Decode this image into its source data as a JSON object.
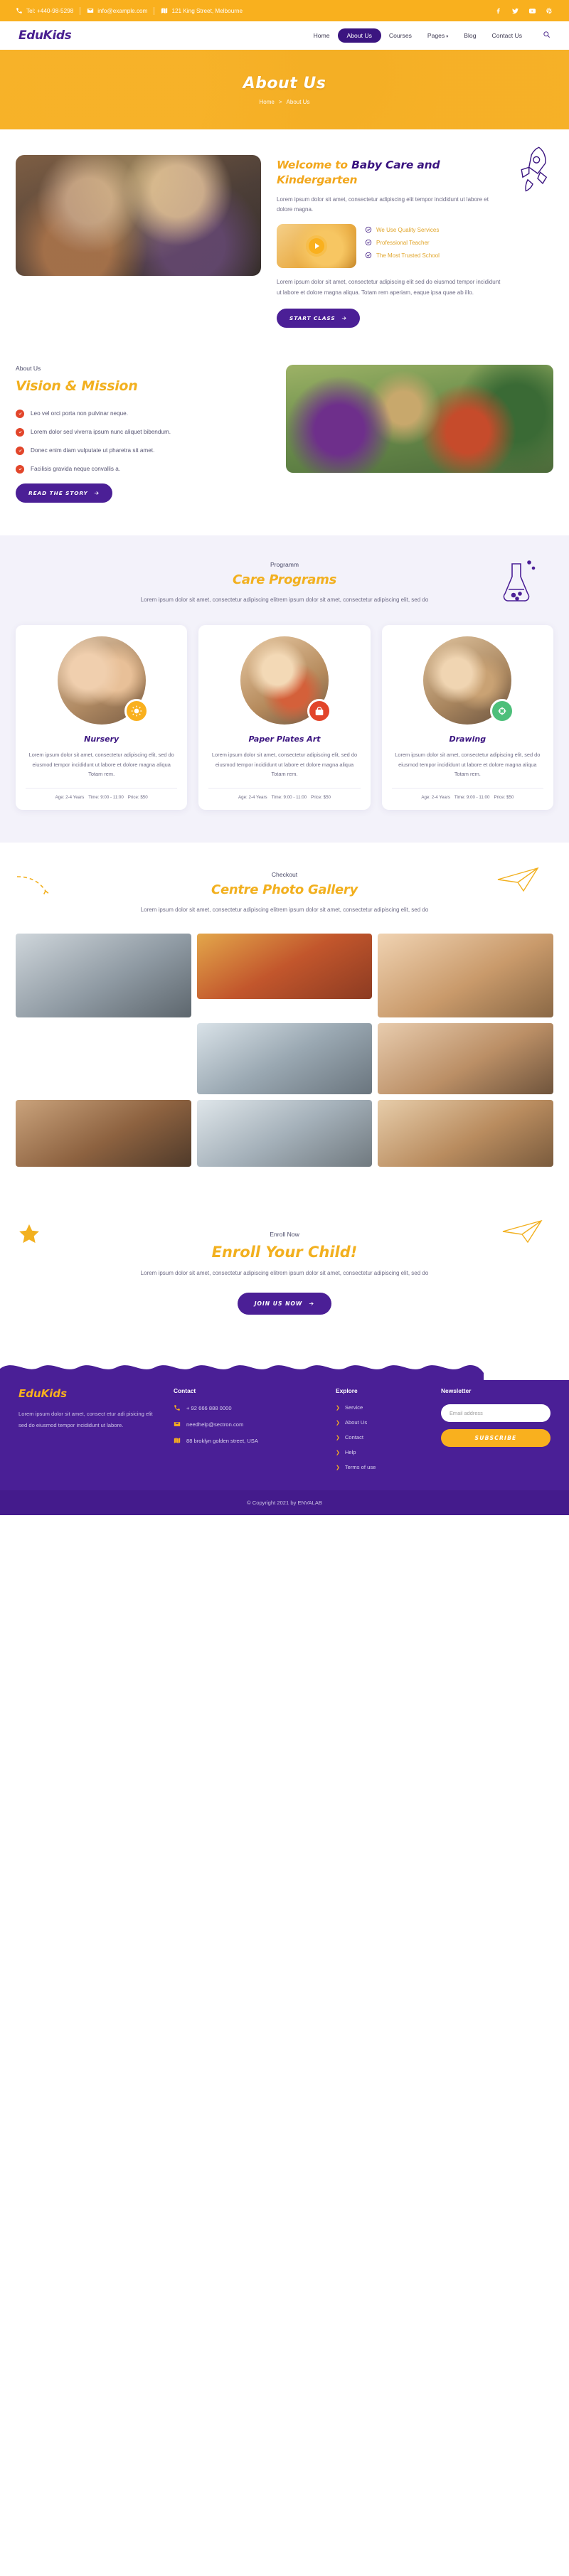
{
  "topbar": {
    "phone": "Tel: +440-98-5298",
    "email": "info@example.com",
    "address": "121 King Street, Melbourne",
    "socials": [
      "facebook-icon",
      "twitter-icon",
      "youtube-icon",
      "pinterest-icon"
    ]
  },
  "nav": {
    "logo": "EduKids",
    "items": [
      {
        "label": "Home",
        "active": false
      },
      {
        "label": "About Us",
        "active": true
      },
      {
        "label": "Courses",
        "active": false
      },
      {
        "label": "Pages",
        "active": false,
        "caret": "▾"
      },
      {
        "label": "Blog",
        "active": false
      },
      {
        "label": "Contact Us",
        "active": false
      }
    ],
    "search_icon": "search-icon"
  },
  "hero": {
    "title": "About Us",
    "breadcrumb_home": "Home",
    "breadcrumb_sep": ">",
    "breadcrumb_current": "About Us"
  },
  "welcome": {
    "title_part1": "Welcome to ",
    "title_part2": "Baby Care and",
    "title_part3": "Kindergarten",
    "lead": "Lorem ipsum dolor sit amet, consectetur adipiscing elit tempor incididunt ut labore et dolore magna.",
    "features": [
      "We Use Quality Services",
      "Professional Teacher",
      "The Most Trusted School"
    ],
    "body": "Lorem ipsum dolor sit amet, consectetur adipiscing elit sed do eiusmod tempor incididunt ut labore et dolore magna aliqua. Totam rem aperiam, eaque ipsa quae ab illo.",
    "cta": "START CLASS"
  },
  "vision": {
    "eyebrow": "About Us",
    "title": "Vision & Mission",
    "items": [
      "Leo vel orci porta non pulvinar neque.",
      "Lorem dolor sed viverra ipsum nunc aliquet bibendum.",
      "Donec enim diam vulputate ut pharetra sit amet.",
      "Facilisis gravida neque convallis a."
    ],
    "cta": "READ THE STORY"
  },
  "programs": {
    "eyebrow": "Programm",
    "title": "Care Programs",
    "subtitle": "Lorem ipsum dolor sit amet, consectetur adipiscing elitrem ipsum dolor sit amet, consectetur adipiscing elit, sed do",
    "cards": [
      {
        "title": "Nursery",
        "text": "Lorem ipsum dolor sit amet, consectetur adipiscing elit, sed do eiusmod tempor incididunt ut labore et dolore magna aliqua Totam rem.",
        "age": "Age: 2-4 Years",
        "time": "Time: 9:00 - 11:00",
        "price": "Price: $50",
        "badge_icon": "sun-icon",
        "badge_color": "#f9b01e"
      },
      {
        "title": "Paper Plates Art",
        "text": "Lorem ipsum dolor sit amet, consectetur adipiscing elit, sed do eiusmod tempor incididunt ut labore et dolore magna aliqua Totam rem.",
        "age": "Age: 2-4 Years",
        "time": "Time: 9:00 - 11:00",
        "price": "Price: $50",
        "badge_icon": "backpack-icon",
        "badge_color": "#e2452a"
      },
      {
        "title": "Drawing",
        "text": "Lorem ipsum dolor sit amet, consectetur adipiscing elit, sed do eiusmod tempor incididunt ut labore et dolore magna aliqua Totam rem.",
        "age": "Age: 2-4 Years",
        "time": "Time: 9:00 - 11:00",
        "price": "Price: $50",
        "badge_icon": "paint-icon",
        "badge_color": "#4dbf7a"
      }
    ]
  },
  "gallery": {
    "eyebrow": "Checkout",
    "title": "Centre Photo Gallery",
    "subtitle": "Lorem ipsum dolor sit amet, consectetur adipiscing elitrem ipsum dolor sit amet, consectetur adipiscing elit, sed do"
  },
  "enroll": {
    "eyebrow": "Enroll Now",
    "title": "Enroll Your Child!",
    "subtitle": "Lorem ipsum dolor sit amet, consectetur adipiscing elitrem ipsum dolor sit amet, consectetur adipiscing elit, sed do",
    "cta": "JOIN US NOW"
  },
  "footer": {
    "logo": "EduKids",
    "description": "Lorem ipsum dolor sit amet, consect etur adi pisicing elit sed do eiusmod tempor incididunt ut labore.",
    "contact_head": "Contact",
    "contact": [
      {
        "icon": "phone-icon",
        "text": "+ 92 666 888 0000"
      },
      {
        "icon": "mail-icon",
        "text": "needhelp@sectron.com"
      },
      {
        "icon": "map-icon",
        "text": "88 broklyn golden street, USA"
      }
    ],
    "explore_head": "Explore",
    "explore": [
      "Service",
      "About Us",
      "Contact",
      "Help",
      "Terms of use"
    ],
    "newsletter_head": "Newsletter",
    "email_placeholder": "Email address",
    "email_value": "",
    "subscribe": "SUBSCRIBE",
    "copyright": "© Copyright 2021 by ENVALAB"
  },
  "colors": {
    "brand_yellow": "#f9b01e",
    "brand_purple": "#4a1f96",
    "accent_red": "#e2452a",
    "accent_green": "#4dbf7a"
  }
}
